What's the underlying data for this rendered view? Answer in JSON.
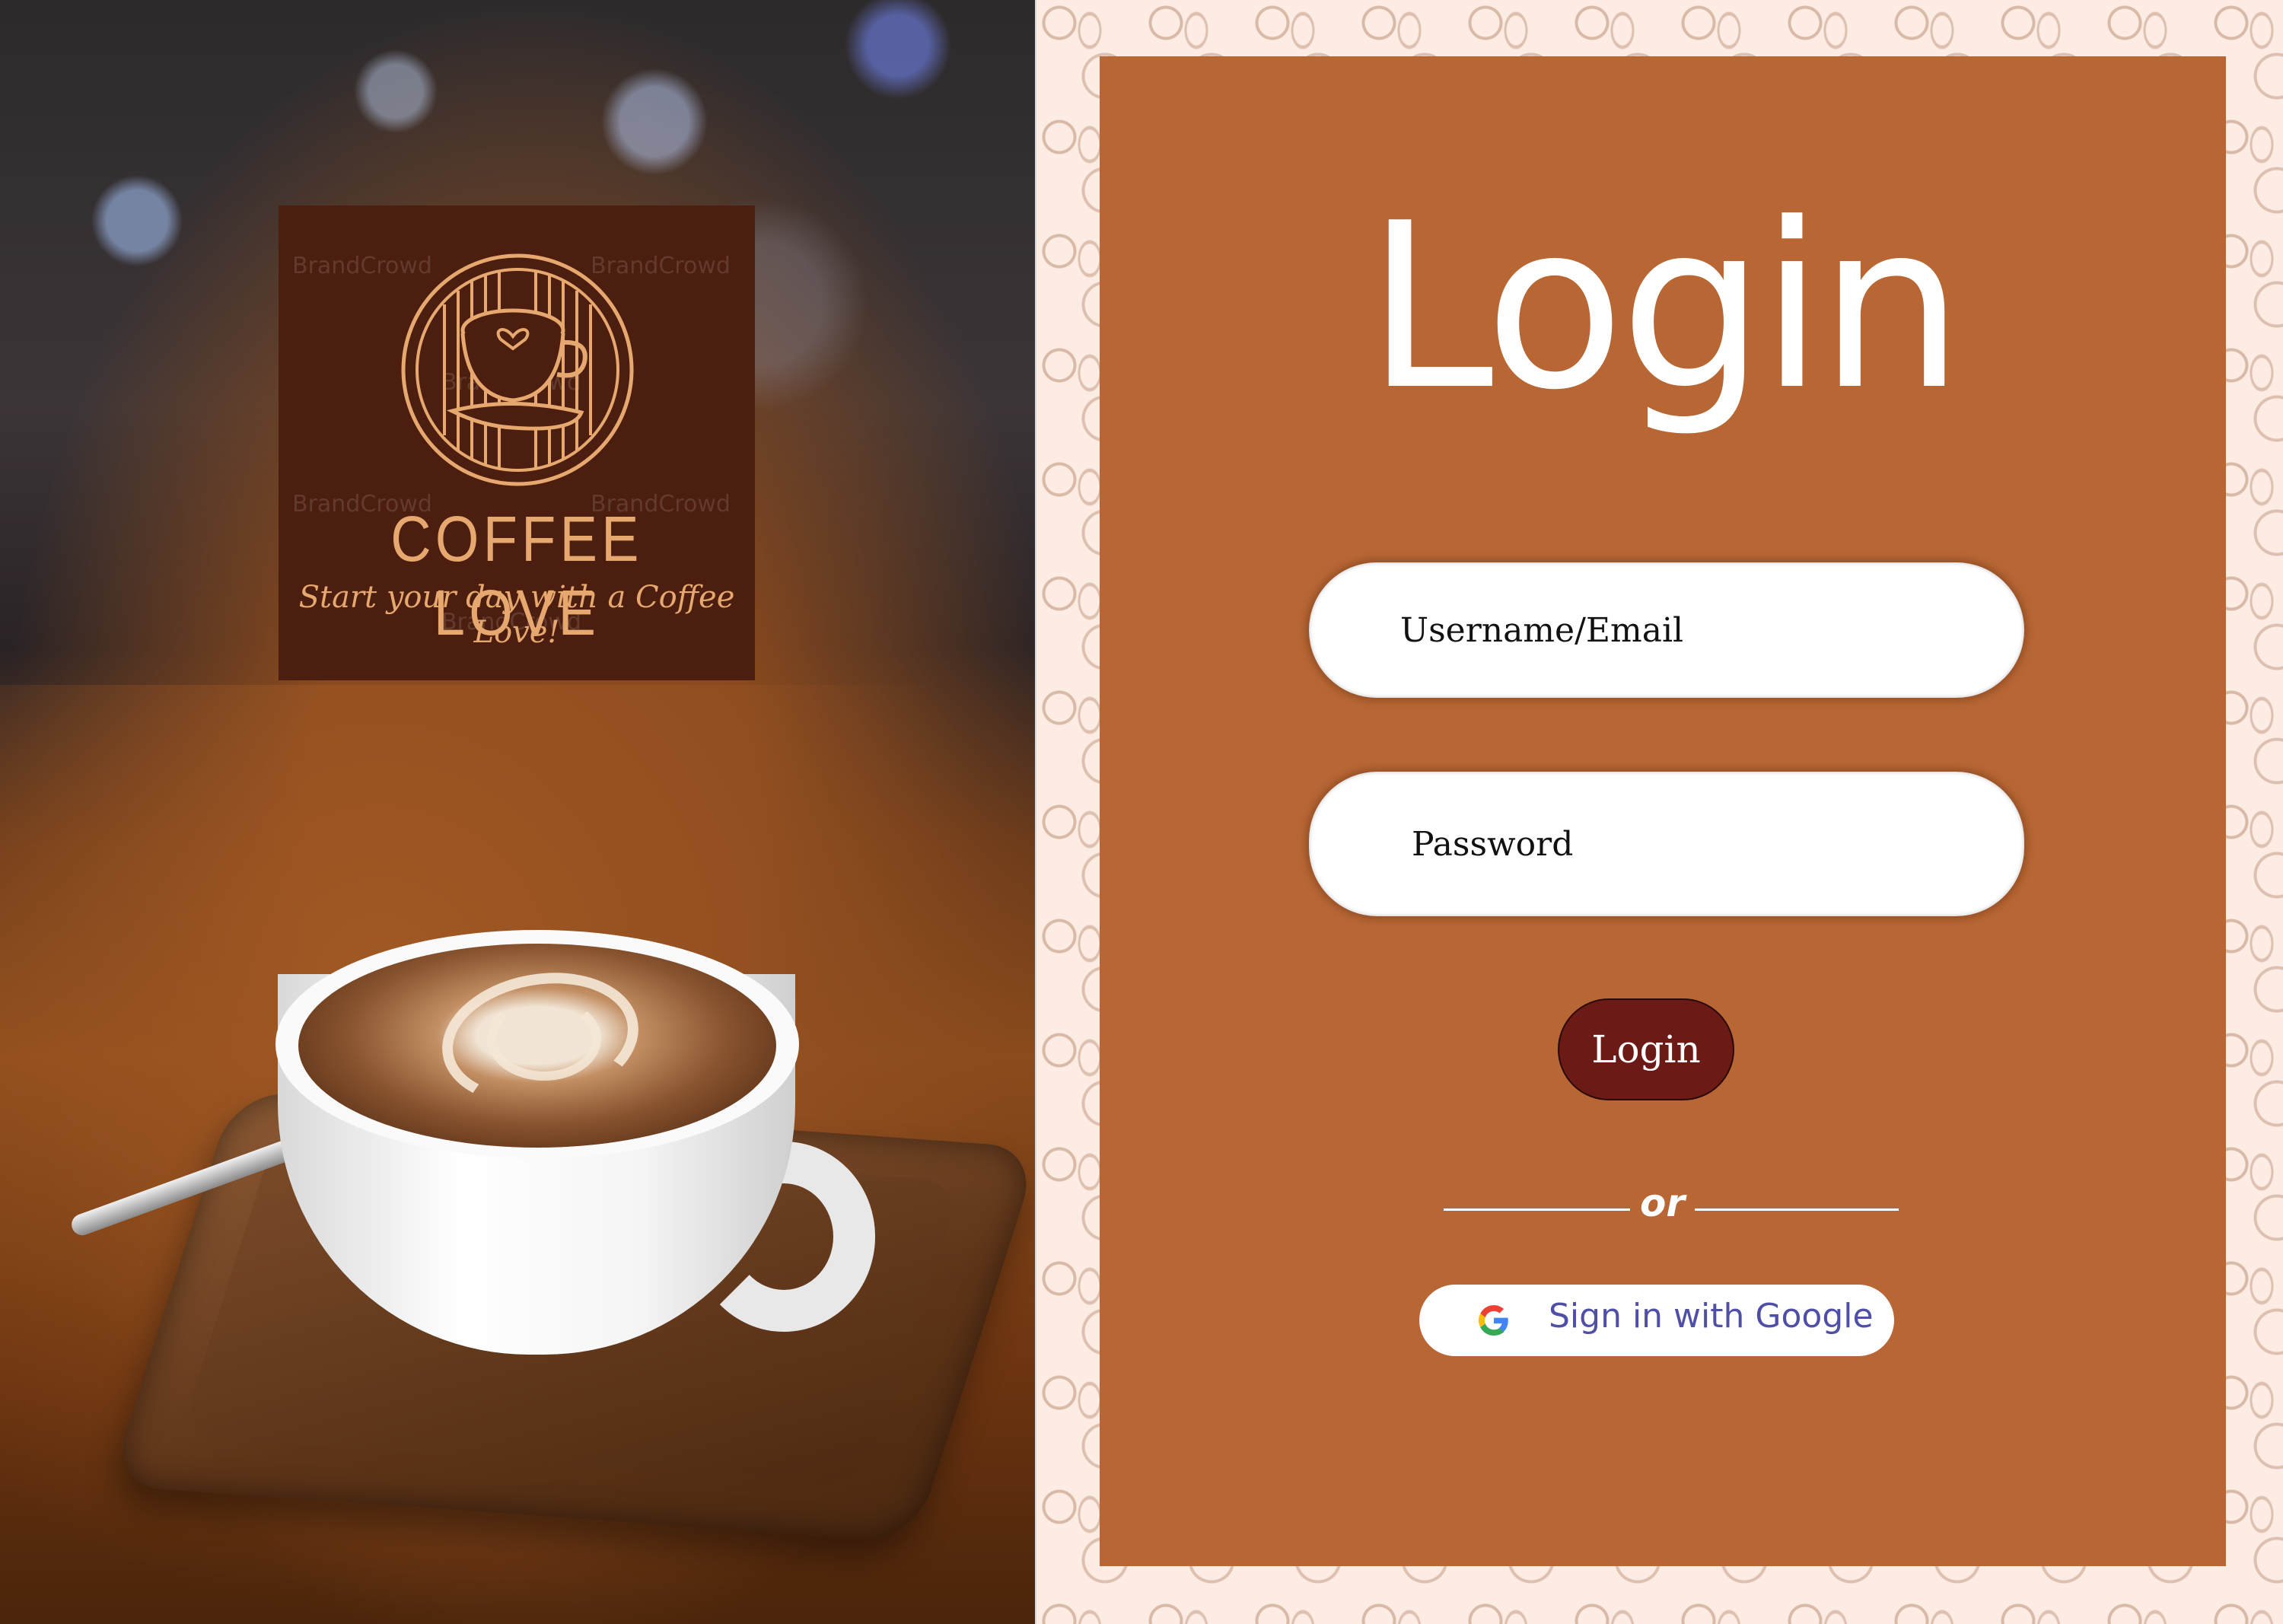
{
  "brand": {
    "name": "COFFEE LOVE",
    "tagline": "Start your day with a Coffee Love!",
    "watermark": "BrandCrowd"
  },
  "login": {
    "title": "Login",
    "username_placeholder": "Username/Email",
    "password_placeholder": "Password",
    "submit_label": "Login",
    "separator": "or",
    "google_label": "Sign in with Google"
  },
  "colors": {
    "card": "#b86734",
    "button": "#6b1a16",
    "logo_bg": "#4b1e0f",
    "logo_text": "#e6a86e",
    "background": "#fcece4",
    "google_text": "#4f4fa8"
  },
  "icons": [
    "coffee-cup-emblem-icon",
    "google-icon"
  ]
}
